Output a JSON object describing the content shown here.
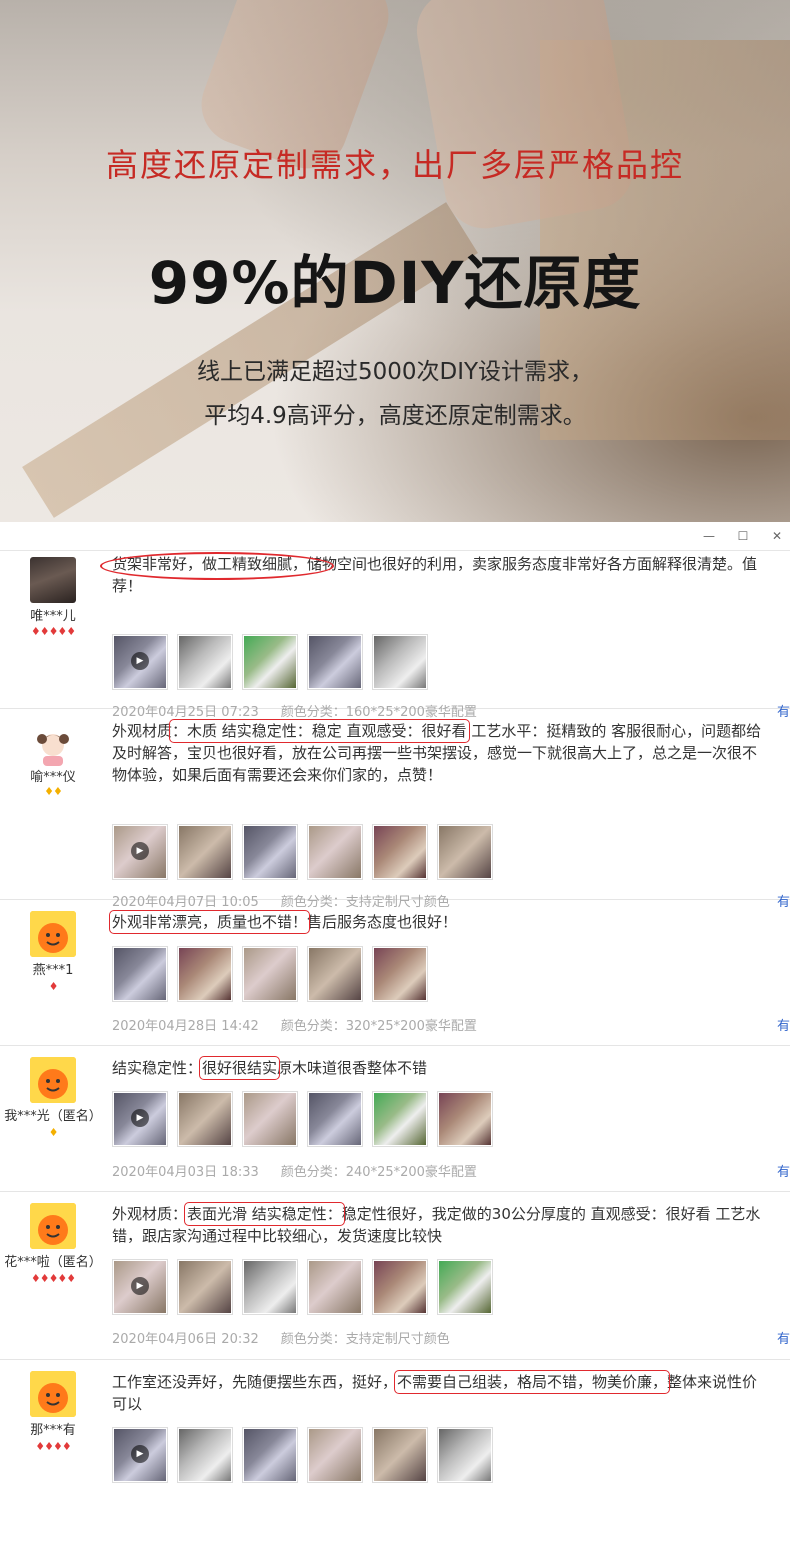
{
  "hero": {
    "red_headline": "高度还原定制需求，出厂多层严格品控",
    "big_headline": "99%的DIY还原度",
    "sub_line1": "线上已满足超过5000次DIY设计需求，",
    "sub_line2": "平均4.9高评分，高度还原定制需求。"
  },
  "window": {
    "minimize_label": "—",
    "maximize_label": "☐",
    "close_label": "✕"
  },
  "colors": {
    "highlight": "#e0292e",
    "headline_red": "#c62a24",
    "link_blue": "#3366cc"
  },
  "reviews": [
    {
      "user": "唯***儿",
      "rank": "♦♦♦♦♦",
      "text_line1": "货架非常好，做工精致细腻，储物空间也很好的利用，卖家服务态度非常好各方面解释很清楚。值",
      "text_line2": "荐！",
      "date": "2020年04月25日 07:23",
      "category": "颜色分类：160*25*200豪华配置",
      "more": "有"
    },
    {
      "user": "喻***仪",
      "rank": "♦♦",
      "text_pre": "外观材质",
      "text_hl": "：木质 结实稳定性：稳定 直观感受：很好看",
      "text_post": " 工艺水平：挺精致的 客服很耐心，问题都给",
      "text_line2": "及时解答，宝贝也很好看，放在公司再摆一些书架摆设，感觉一下就很高大上了，总之是一次很不",
      "text_line3": "物体验，如果后面有需要还会来你们家的，点赞！",
      "date": "2020年04月07日 10:05",
      "category": "颜色分类：支持定制尺寸颜色",
      "more": "有"
    },
    {
      "user": "燕***1",
      "rank": "♦",
      "text_hl": "外观非常漂亮，质量也不错！",
      "text_post": "售后服务态度也很好！",
      "date": "2020年04月28日 14:42",
      "category": "颜色分类：320*25*200豪华配置",
      "more": "有"
    },
    {
      "user": "我***光（匿名）",
      "rank": "♦",
      "text_pre": "结实稳定性：",
      "text_hl": "很好很结实",
      "text_post": "原木味道很香整体不错",
      "date": "2020年04月03日 18:33",
      "category": "颜色分类：240*25*200豪华配置",
      "more": "有"
    },
    {
      "user": "花***啦（匿名）",
      "rank": "♦♦♦♦♦",
      "text_pre": "外观材质：",
      "text_hl": "表面光滑 结实稳定性：",
      "text_post": "稳定性很好，我定做的30公分厚度的 直观感受：很好看 工艺水",
      "text_line2": "错，跟店家沟通过程中比较细心，发货速度比较快",
      "date": "2020年04月06日 20:32",
      "category": "颜色分类：支持定制尺寸颜色",
      "more": "有"
    },
    {
      "user": "那***有",
      "rank": "♦♦♦♦",
      "text_pre": "工作室还没弄好，先随便摆些东西，挺好，",
      "text_hl": "不需要自己组装，格局不错，物美价廉，",
      "text_post": "整体来说性价",
      "text_line2": "可以"
    }
  ]
}
